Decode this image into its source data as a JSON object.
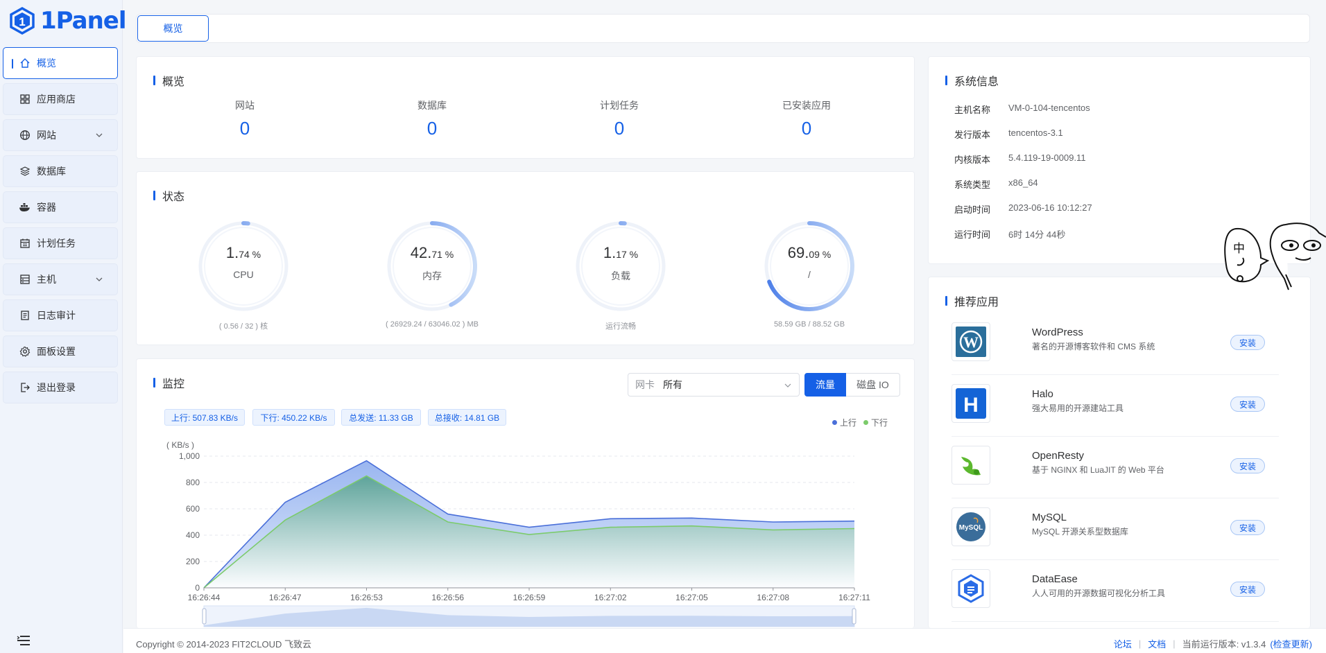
{
  "brand": {
    "name": "1Panel",
    "color": "#1560e6"
  },
  "sidebar": {
    "items": [
      {
        "label": "概览",
        "icon": "home-icon",
        "active": true
      },
      {
        "label": "应用商店",
        "icon": "grid-icon"
      },
      {
        "label": "网站",
        "icon": "globe-icon",
        "expandable": true
      },
      {
        "label": "数据库",
        "icon": "layers-icon"
      },
      {
        "label": "容器",
        "icon": "docker-icon"
      },
      {
        "label": "计划任务",
        "icon": "calendar-icon"
      },
      {
        "label": "主机",
        "icon": "server-icon",
        "expandable": true
      },
      {
        "label": "日志审计",
        "icon": "log-icon"
      },
      {
        "label": "面板设置",
        "icon": "gear-icon"
      },
      {
        "label": "退出登录",
        "icon": "logout-icon"
      }
    ]
  },
  "tabs": [
    {
      "label": "概览"
    }
  ],
  "overview": {
    "title": "概览",
    "items": [
      {
        "label": "网站",
        "value": "0"
      },
      {
        "label": "数据库",
        "value": "0"
      },
      {
        "label": "计划任务",
        "value": "0"
      },
      {
        "label": "已安装应用",
        "value": "0"
      }
    ]
  },
  "status": {
    "title": "状态",
    "gauges": [
      {
        "int": "1.",
        "dec": "74 %",
        "name": "CPU",
        "sub": "( 0.56 / 32 ) 核",
        "percent": 1.74
      },
      {
        "int": "42.",
        "dec": "71 %",
        "name": "内存",
        "sub": "( 26929.24 / 63046.02 ) MB",
        "percent": 42.71
      },
      {
        "int": "1.",
        "dec": "17 %",
        "name": "负载",
        "sub": "运行流畅",
        "percent": 1.17
      },
      {
        "int": "69.",
        "dec": "09 %",
        "name": "/",
        "sub": "58.59 GB / 88.52 GB",
        "percent": 69.09
      }
    ]
  },
  "monitor": {
    "title": "监控",
    "nic_prefix": "网卡",
    "nic_value": "所有",
    "btn_traffic": "流量",
    "btn_disk": "磁盘 IO",
    "chips": [
      "上行: 507.83 KB/s",
      "下行: 450.22 KB/s",
      "总发送: 11.33 GB",
      "总接收: 14.81 GB"
    ],
    "legend_up": "上行",
    "legend_down": "下行",
    "up_color": "#4a6fd9",
    "down_color": "#7ccb6b"
  },
  "chart_data": {
    "type": "area",
    "ylabel": "( KB/s )",
    "ylim": [
      0,
      1000
    ],
    "yticks": [
      "1,000",
      "800",
      "600",
      "400",
      "200",
      "0"
    ],
    "categories": [
      "16:26:44",
      "16:26:47",
      "16:26:53",
      "16:26:56",
      "16:26:59",
      "16:27:02",
      "16:27:05",
      "16:27:08",
      "16:27:11"
    ],
    "series": [
      {
        "name": "上行",
        "values": [
          0,
          650,
          965,
          560,
          460,
          525,
          530,
          500,
          507
        ]
      },
      {
        "name": "下行",
        "values": [
          0,
          515,
          850,
          500,
          405,
          460,
          470,
          440,
          450
        ]
      }
    ]
  },
  "system_info": {
    "title": "系统信息",
    "rows": [
      {
        "k": "主机名称",
        "v": "VM-0-104-tencentos"
      },
      {
        "k": "发行版本",
        "v": "tencentos-3.1"
      },
      {
        "k": "内核版本",
        "v": "5.4.119-19-0009.11"
      },
      {
        "k": "系统类型",
        "v": "x86_64"
      },
      {
        "k": "启动时间",
        "v": "2023-06-16 10:12:27"
      },
      {
        "k": "运行时间",
        "v": "6时 14分 44秒"
      }
    ]
  },
  "recommended": {
    "title": "推荐应用",
    "install_label": "安装",
    "apps": [
      {
        "name": "WordPress",
        "desc": "著名的开源博客软件和 CMS 系统",
        "icon": "wordpress-icon"
      },
      {
        "name": "Halo",
        "desc": "强大易用的开源建站工具",
        "icon": "halo-icon"
      },
      {
        "name": "OpenResty",
        "desc": "基于 NGINX 和 LuaJIT 的 Web 平台",
        "icon": "openresty-icon"
      },
      {
        "name": "MySQL",
        "desc": "MySQL 开源关系型数据库",
        "icon": "mysql-icon"
      },
      {
        "name": "DataEase",
        "desc": "人人可用的开源数据可视化分析工具",
        "icon": "dataease-icon"
      }
    ]
  },
  "doodle": {
    "char": "中"
  },
  "footer": {
    "copyright": "Copyright © 2014-2023 FIT2CLOUD 飞致云",
    "forum": "论坛",
    "docs": "文档",
    "version_label": "当前运行版本: v1.3.4",
    "check_update": "(检查更新)"
  }
}
